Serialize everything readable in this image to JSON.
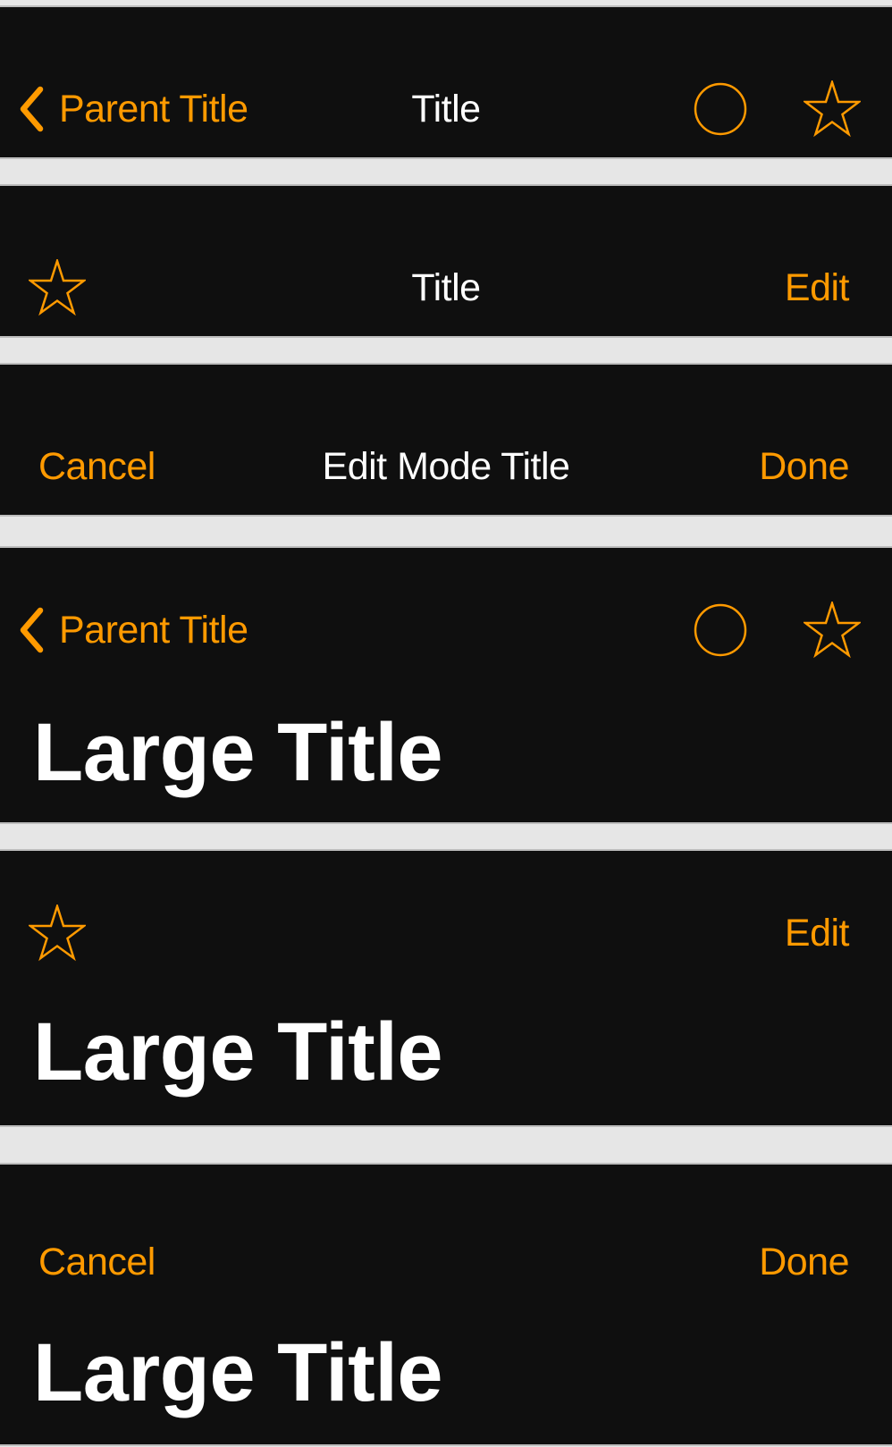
{
  "colors": {
    "accent": "#ff9a00",
    "bar_background": "#0f0f0f",
    "page_background": "#e6e6e6",
    "title_text": "#ffffff"
  },
  "bars": [
    {
      "back": {
        "label": "Parent Title",
        "icon": "chevron-left-icon"
      },
      "title": "Title",
      "right_icons": [
        "circle-icon",
        "star-icon"
      ]
    },
    {
      "left_icon": "star-icon",
      "title": "Title",
      "right_button": "Edit"
    },
    {
      "left_button": "Cancel",
      "title": "Edit Mode Title",
      "right_button": "Done"
    },
    {
      "back": {
        "label": "Parent Title",
        "icon": "chevron-left-icon"
      },
      "right_icons": [
        "circle-icon",
        "star-icon"
      ],
      "large_title": "Large Title"
    },
    {
      "left_icon": "star-icon",
      "right_button": "Edit",
      "large_title": "Large Title"
    },
    {
      "left_button": "Cancel",
      "right_button": "Done",
      "large_title": "Large Title"
    }
  ]
}
